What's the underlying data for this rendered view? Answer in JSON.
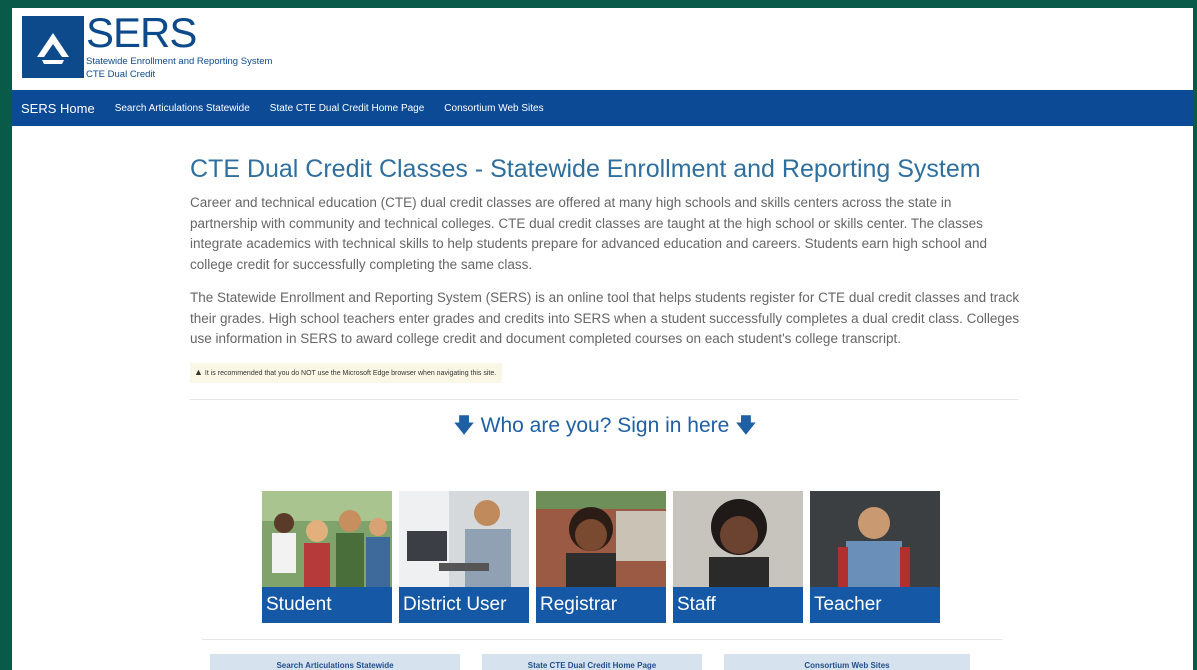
{
  "header": {
    "logo_title": "SERS",
    "logo_subtitle_1": "Statewide Enrollment and Reporting System",
    "logo_subtitle_2": "CTE Dual Credit"
  },
  "nav": {
    "home": "SERS Home",
    "items": [
      "Search Articulations Statewide",
      "State CTE Dual Credit Home Page",
      "Consortium Web Sites"
    ]
  },
  "main": {
    "title": "CTE Dual Credit Classes - Statewide Enrollment and Reporting System",
    "paragraph1": "Career and technical education (CTE) dual credit classes are offered at many high schools and skills centers across the state in partnership with community and technical colleges. CTE dual credit classes are taught at the high school or skills center. The classes integrate academics with technical skills to help students prepare for advanced education and careers. Students earn high school and college credit for successfully completing the same class.",
    "paragraph2": "The Statewide Enrollment and Reporting System (SERS) is an online tool that helps students register for CTE dual credit classes and track their grades. High school teachers enter grades and credits into SERS when a student successfully completes a dual credit class. Colleges use information in SERS to award college credit and document completed courses on each student's college transcript.",
    "warning": "It is recommended that you do NOT use the Microsoft Edge browser when navigating this site.",
    "signin": "Who are you? Sign in here",
    "signin_arrow": "🡇"
  },
  "roles": [
    "Student",
    "District User",
    "Registrar",
    "Staff",
    "Teacher"
  ],
  "footer_buttons": [
    "Search Articulations Statewide",
    "State CTE Dual Credit Home Page",
    "Consortium Web Sites"
  ],
  "colors": {
    "brand_blue": "#0c4a96",
    "title_blue": "#2f6f9e",
    "frame_green": "#0a5a4a"
  }
}
